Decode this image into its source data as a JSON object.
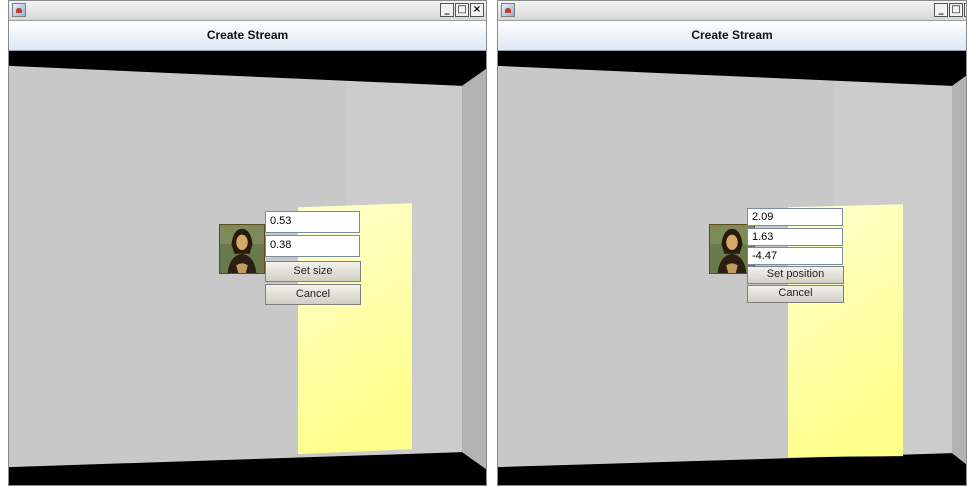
{
  "windows": [
    {
      "header_title": "Create Stream",
      "controls": [
        "_",
        "□",
        "×"
      ],
      "app_icon": "java-cup-icon",
      "image": "mona-lisa-thumbnail",
      "fields": [
        "0.53",
        "0.38"
      ],
      "buttons": [
        "Set size",
        "Cancel"
      ]
    },
    {
      "header_title": "Create Stream",
      "controls": [
        "_",
        "□",
        "×"
      ],
      "app_icon": "java-cup-icon",
      "image": "mona-lisa-thumbnail",
      "fields": [
        "2.09",
        "1.63",
        "-4.47"
      ],
      "buttons": [
        "Set position",
        "Cancel"
      ]
    }
  ],
  "colors": {
    "wall": "#c8c8c8",
    "floor_ceiling": "#000000",
    "light_panel": "#ffff9a",
    "header_gradient_end": "#dde7f3"
  }
}
